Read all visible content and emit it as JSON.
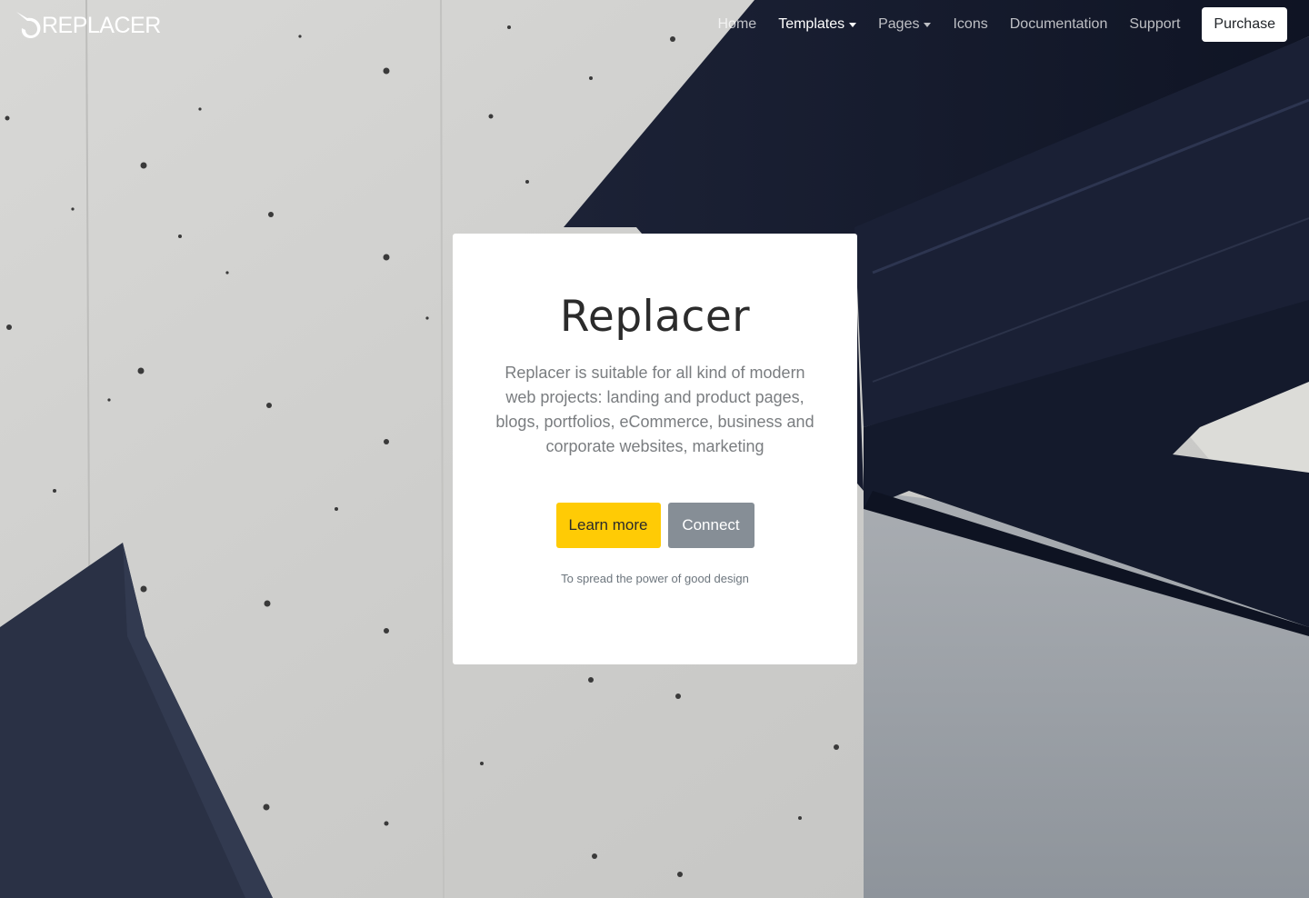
{
  "brand": {
    "name": "REPLACER",
    "logo_icon": "rocket-swoosh-icon"
  },
  "nav": {
    "items": [
      {
        "label": "Home",
        "dropdown": false,
        "active": false
      },
      {
        "label": "Templates",
        "dropdown": true,
        "active": true
      },
      {
        "label": "Pages",
        "dropdown": true,
        "active": false
      },
      {
        "label": "Icons",
        "dropdown": false,
        "active": false
      },
      {
        "label": "Documentation",
        "dropdown": false,
        "active": false
      },
      {
        "label": "Support",
        "dropdown": false,
        "active": false
      }
    ],
    "purchase_label": "Purchase"
  },
  "hero": {
    "title": "Replacer",
    "description": "Replacer is suitable for all kind of modern web projects: landing and product pages, blogs, portfolios, eCommerce, business and corporate websites, marketing",
    "primary_button": "Learn more",
    "secondary_button": "Connect",
    "tagline": "To spread the power of good design"
  },
  "colors": {
    "primary_button": "#ffcb05",
    "secondary_button": "#868e96",
    "card_background": "#ffffff",
    "nav_text": "#ffffff"
  }
}
